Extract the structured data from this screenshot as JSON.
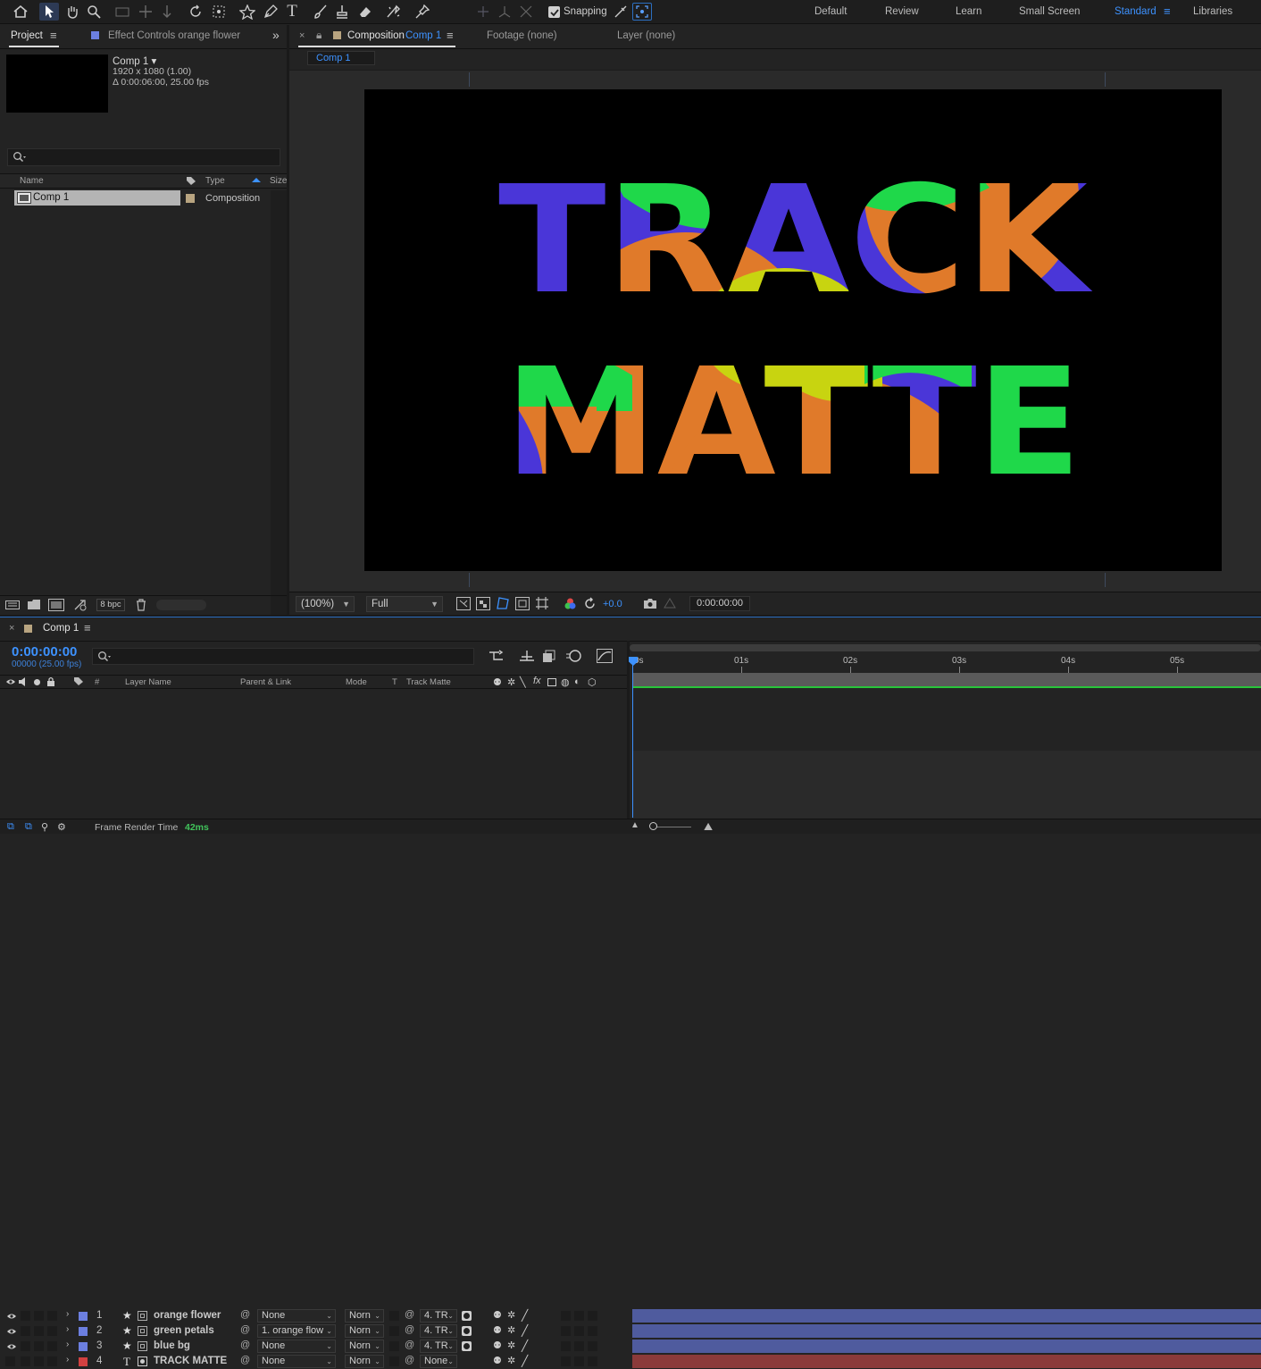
{
  "toolbar": {
    "snapping_label": "Snapping",
    "workspaces": [
      "Default",
      "Review",
      "Learn",
      "Small Screen",
      "Standard",
      "Libraries"
    ],
    "active_workspace": "Standard"
  },
  "project_panel": {
    "tab_project": "Project",
    "tab_effect_controls": "Effect Controls orange flower",
    "comp_name": "Comp 1 ▾",
    "comp_resolution": "1920 x 1080 (1.00)",
    "comp_duration": "Δ 0:00:06:00, 25.00 fps",
    "col_name": "Name",
    "col_type": "Type",
    "col_size": "Size",
    "item_name": "Comp 1",
    "item_type": "Composition",
    "bpc": "8 bpc"
  },
  "comp_panel": {
    "tab_composition": "Composition",
    "tab_comp_name": "Comp 1",
    "tab_footage": "Footage (none)",
    "tab_layer": "Layer (none)",
    "subtab": "Comp 1",
    "canvas_text_line1": "TRACK",
    "canvas_text_line2": "MATTE",
    "zoom": "(100%)",
    "resolution": "Full",
    "exposure": "+0.0",
    "timecode": "0:00:00:00"
  },
  "timeline": {
    "tab": "Comp 1",
    "timecode": "0:00:00:00",
    "frame_info": "00000 (25.00 fps)",
    "col_hash": "#",
    "col_layer_name": "Layer Name",
    "col_parent": "Parent & Link",
    "col_mode": "Mode",
    "col_t": "T",
    "col_track_matte": "Track Matte",
    "ruler": [
      "0s",
      "01s",
      "02s",
      "03s",
      "04s",
      "05s"
    ],
    "layers": [
      {
        "num": "1",
        "name": "orange flower",
        "parent": "None",
        "mode": "Norn",
        "matte": "4. TR",
        "color": "#6c7fe0",
        "bar": "#4f5b9e"
      },
      {
        "num": "2",
        "name": "green petals",
        "parent": "1. orange flow",
        "mode": "Norn",
        "matte": "4. TR",
        "color": "#6c7fe0",
        "bar": "#4f5b9e"
      },
      {
        "num": "3",
        "name": "blue bg",
        "parent": "None",
        "mode": "Norn",
        "matte": "4. TR",
        "color": "#6c7fe0",
        "bar": "#4f5b9e"
      },
      {
        "num": "4",
        "name": "TRACK MATTE",
        "parent": "None",
        "mode": "Norn",
        "matte": "None",
        "color": "#d24040",
        "bar": "#8b3a3a"
      }
    ],
    "render_label": "Frame Render Time",
    "render_value": "42ms"
  }
}
